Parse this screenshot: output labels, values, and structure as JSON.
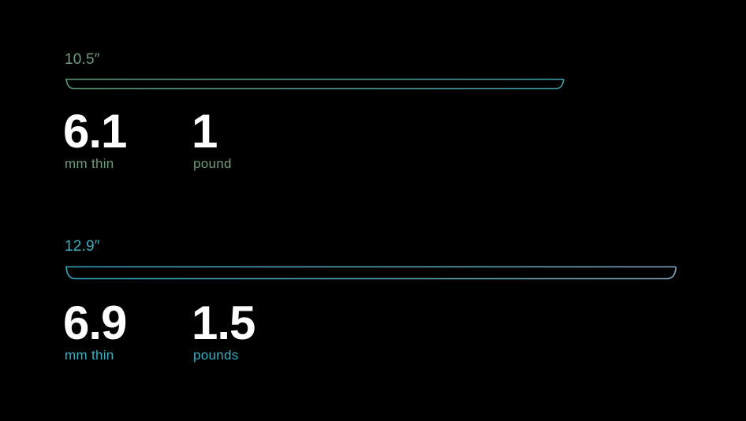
{
  "colors": {
    "background": "#000000",
    "small_accent": "#6f9c7b",
    "large_accent": "#3aaec3",
    "value_text": "#ffffff"
  },
  "models": [
    {
      "size": "10.5″",
      "thickness_value": "6.1",
      "thickness_unit": "mm thin",
      "weight_value": "1",
      "weight_unit": "pound"
    },
    {
      "size": "12.9″",
      "thickness_value": "6.9",
      "thickness_unit": "mm thin",
      "weight_value": "1.5",
      "weight_unit": "pounds"
    }
  ]
}
